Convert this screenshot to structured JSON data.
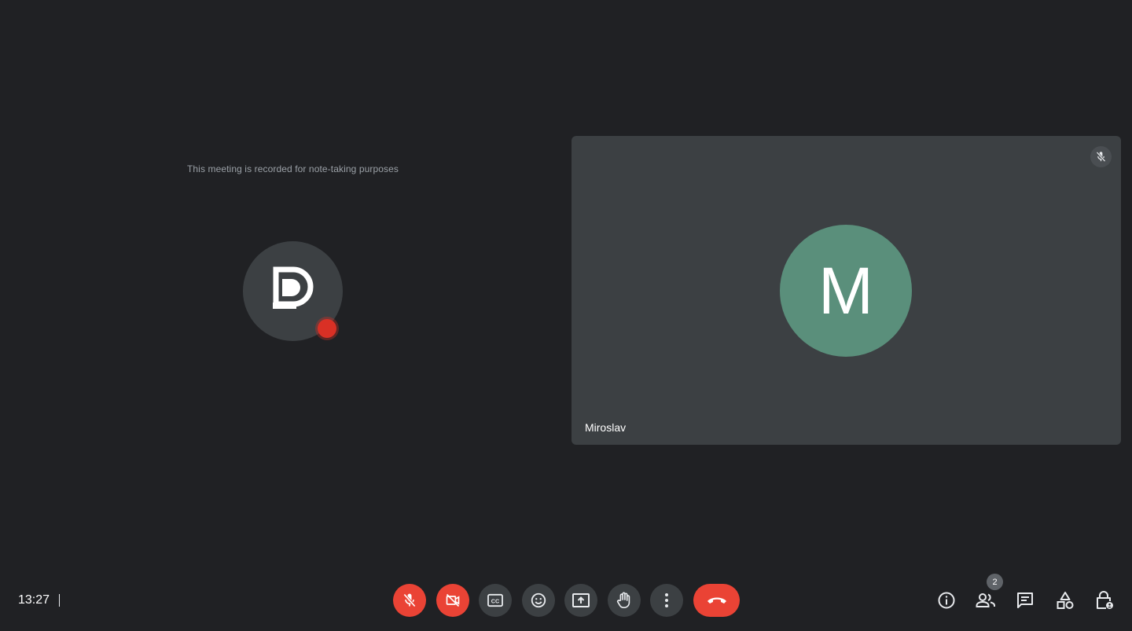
{
  "meeting": {
    "record_notice": "This meeting is recorded for note-taking purposes"
  },
  "participant": {
    "initial": "M",
    "name": "Miroslav",
    "avatar_color": "#5a8f7b"
  },
  "status": {
    "time": "13:27",
    "participant_count": "2"
  },
  "controls": [
    {
      "name": "microphone-off",
      "icon": "mic-off-icon"
    },
    {
      "name": "camera-off",
      "icon": "videocam-off-icon"
    },
    {
      "name": "captions",
      "icon": "closed-captions-icon"
    },
    {
      "name": "reactions",
      "icon": "emoji-icon"
    },
    {
      "name": "present-screen",
      "icon": "present-to-all-icon"
    },
    {
      "name": "raise-hand",
      "icon": "hand-icon"
    },
    {
      "name": "more-options",
      "icon": "more-vert-icon"
    },
    {
      "name": "leave-call",
      "icon": "call-end-icon"
    }
  ],
  "side_controls": [
    {
      "name": "meeting-details",
      "icon": "info-icon"
    },
    {
      "name": "people",
      "icon": "people-icon"
    },
    {
      "name": "chat",
      "icon": "chat-icon"
    },
    {
      "name": "activities",
      "icon": "shapes-icon"
    },
    {
      "name": "host-controls",
      "icon": "lock-person-icon"
    }
  ],
  "colors": {
    "background": "#202124",
    "tile": "#3c4043",
    "danger": "#ea4335",
    "record": "#d93025"
  }
}
